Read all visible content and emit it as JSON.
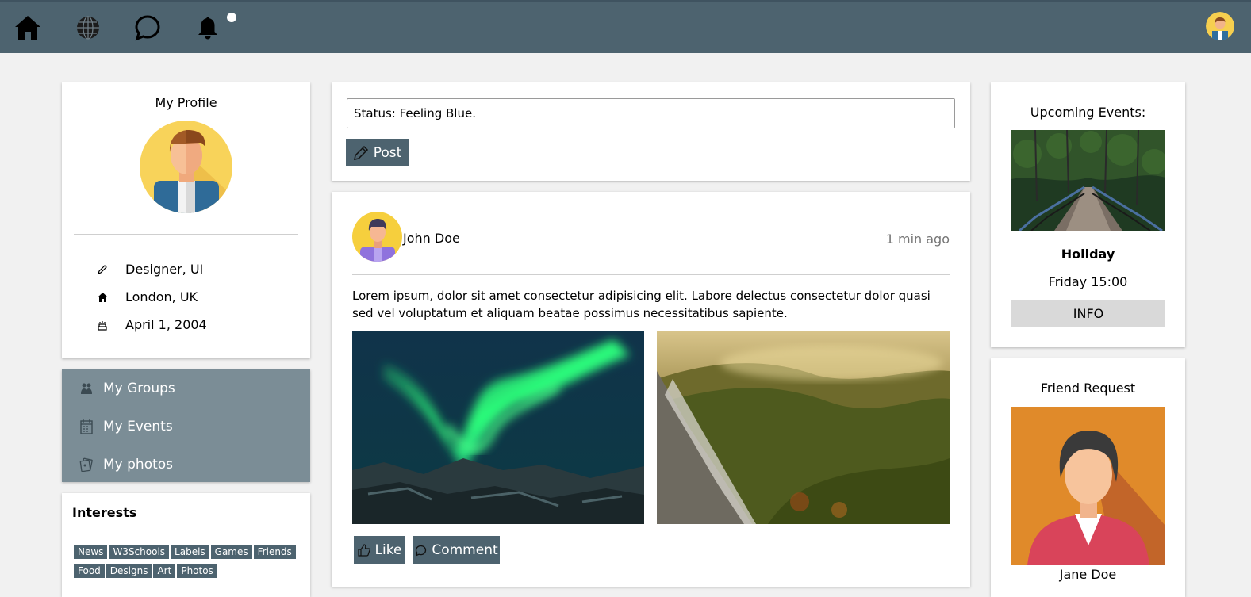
{
  "topbar": {
    "nav": [
      "home-icon",
      "globe-icon",
      "chat-icon",
      "bell-icon"
    ],
    "colors": {
      "bar": "#4d636f",
      "accent": "#4d636f"
    }
  },
  "profile": {
    "title": "My Profile",
    "details": [
      {
        "icon": "pencil-icon",
        "text": "Designer, UI"
      },
      {
        "icon": "home-icon",
        "text": "London, UK"
      },
      {
        "icon": "birthday-cake-icon",
        "text": "April 1, 2004"
      }
    ]
  },
  "menu": {
    "items": [
      {
        "icon": "users-icon",
        "label": "My Groups"
      },
      {
        "icon": "calendar-icon",
        "label": "My Events"
      },
      {
        "icon": "photos-icon",
        "label": "My photos"
      }
    ]
  },
  "interests": {
    "title": "Interests",
    "tags": [
      "News",
      "W3Schools",
      "Labels",
      "Games",
      "Friends",
      "Food",
      "Designs",
      "Art",
      "Photos"
    ]
  },
  "composer": {
    "status_value": "Status: Feeling Blue.",
    "post_label": "Post"
  },
  "post": {
    "author": "John Doe",
    "time": "1 min ago",
    "text": "Lorem ipsum, dolor sit amet consectetur adipisicing elit. Labore delectus consectetur dolor quasi sed vel voluptatum et aliquam beatae possimus necessitatibus sapiente.",
    "like_label": "Like",
    "comment_label": "Comment"
  },
  "events": {
    "title": "Upcoming Events:",
    "name": "Holiday",
    "time": "Friday 15:00",
    "info_label": "INFO"
  },
  "friend_request": {
    "title": "Friend Request",
    "name": "Jane Doe"
  }
}
